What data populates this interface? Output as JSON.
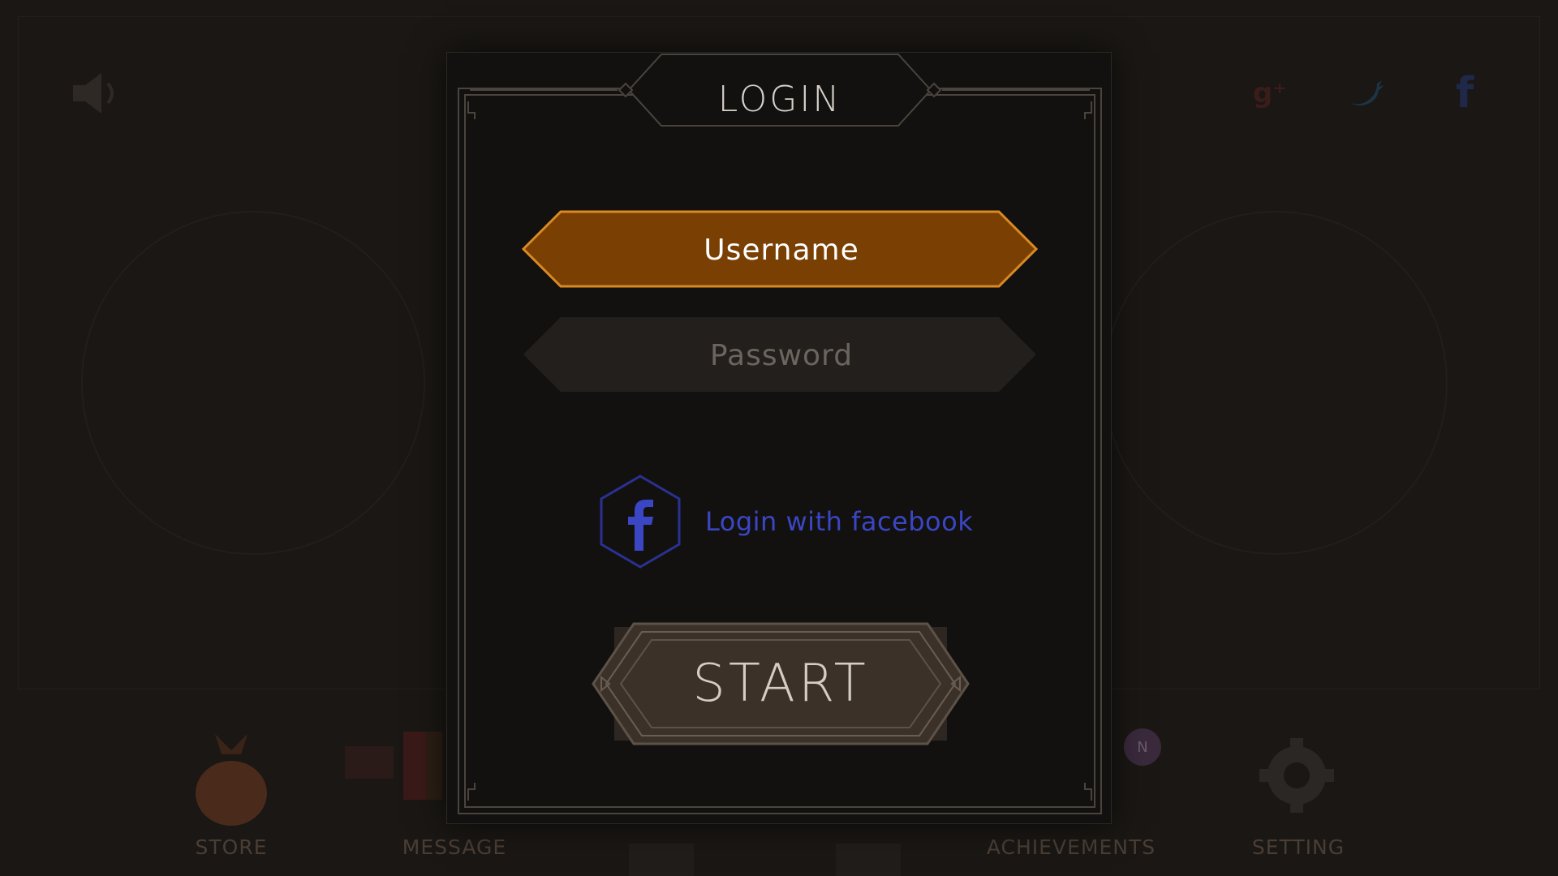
{
  "background": {
    "nav": [
      {
        "label": "STORE",
        "icon": "money-bag-icon"
      },
      {
        "label": "MESSAGE",
        "icon": "message-icon"
      },
      {
        "label": "ACHIEVEMENTS",
        "icon": "trophy-icon"
      },
      {
        "label": "SETTING",
        "icon": "gear-icon"
      }
    ],
    "badge": "N",
    "social": [
      "google-plus-icon",
      "twitter-icon",
      "facebook-icon"
    ],
    "sound_icon": "speaker-icon"
  },
  "login": {
    "title": "LOGIN",
    "username_placeholder": "Username",
    "password_placeholder": "Password",
    "facebook_label": "Login with facebook",
    "start_label": "START"
  },
  "colors": {
    "accent": "#7a3f02",
    "accent_border": "#d98a22",
    "facebook": "#3b46c4",
    "field_inactive": "#231f1c",
    "start_fill": "#3b3128"
  }
}
